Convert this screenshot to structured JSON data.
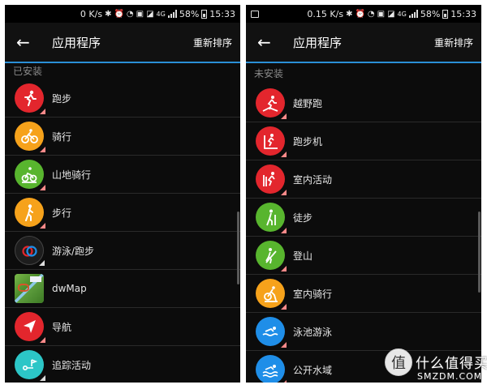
{
  "left": {
    "status": {
      "speed": "0 K/s",
      "network": "4G",
      "battery": "58%",
      "time": "15:33"
    },
    "header": {
      "title": "应用程序",
      "action": "重新排序"
    },
    "section": "已安装",
    "items": [
      {
        "label": "跑步",
        "icon": "running-icon",
        "color": "#e3262d",
        "badge": "#ff8a8a"
      },
      {
        "label": "骑行",
        "icon": "cycling-icon",
        "color": "#f6a21b",
        "badge": "#ff8a8a"
      },
      {
        "label": "山地骑行",
        "icon": "mountain-bike-icon",
        "color": "#58b52e",
        "badge": "#ff8a8a"
      },
      {
        "label": "步行",
        "icon": "walking-icon",
        "color": "#f6a21b",
        "badge": "#ff8a8a"
      },
      {
        "label": "游泳/跑步",
        "icon": "swimrun-icon",
        "color": "#1d1d1d",
        "badge": "#dddddd"
      },
      {
        "label": "dwMap",
        "icon": "map-icon",
        "color": "#5a9a3a",
        "badge": ""
      },
      {
        "label": "导航",
        "icon": "navigation-icon",
        "color": "#e3262d",
        "badge": "#ff8a8a"
      },
      {
        "label": "追踪活动",
        "icon": "track-icon",
        "color": "#2cc6c7",
        "badge": "#dddddd"
      }
    ]
  },
  "right": {
    "status": {
      "speed": "0.15 K/s",
      "network": "4G",
      "battery": "58%",
      "time": "15:33"
    },
    "header": {
      "title": "应用程序",
      "action": "重新排序"
    },
    "section": "未安装",
    "items": [
      {
        "label": "越野跑",
        "icon": "trail-run-icon",
        "color": "#e3262d",
        "badge": "#ff8a8a"
      },
      {
        "label": "跑步机",
        "icon": "treadmill-icon",
        "color": "#e3262d",
        "badge": "#ff8a8a"
      },
      {
        "label": "室内活动",
        "icon": "indoor-activity-icon",
        "color": "#e3262d",
        "badge": "#ff8a8a"
      },
      {
        "label": "徒步",
        "icon": "hiking-icon",
        "color": "#58b52e",
        "badge": "#ff8a8a"
      },
      {
        "label": "登山",
        "icon": "climbing-icon",
        "color": "#58b52e",
        "badge": "#ff8a8a"
      },
      {
        "label": "室内骑行",
        "icon": "indoor-cycling-icon",
        "color": "#f6a21b",
        "badge": "#ff8a8a"
      },
      {
        "label": "泳池游泳",
        "icon": "pool-swim-icon",
        "color": "#1f8ee8",
        "badge": "#ff8a8a"
      },
      {
        "label": "公开水域",
        "icon": "open-water-icon",
        "color": "#1f8ee8",
        "badge": "#ff8a8a"
      }
    ]
  },
  "watermark": {
    "cn": "什么值得买",
    "en": "SMZDM.COM",
    "mark": "值"
  }
}
